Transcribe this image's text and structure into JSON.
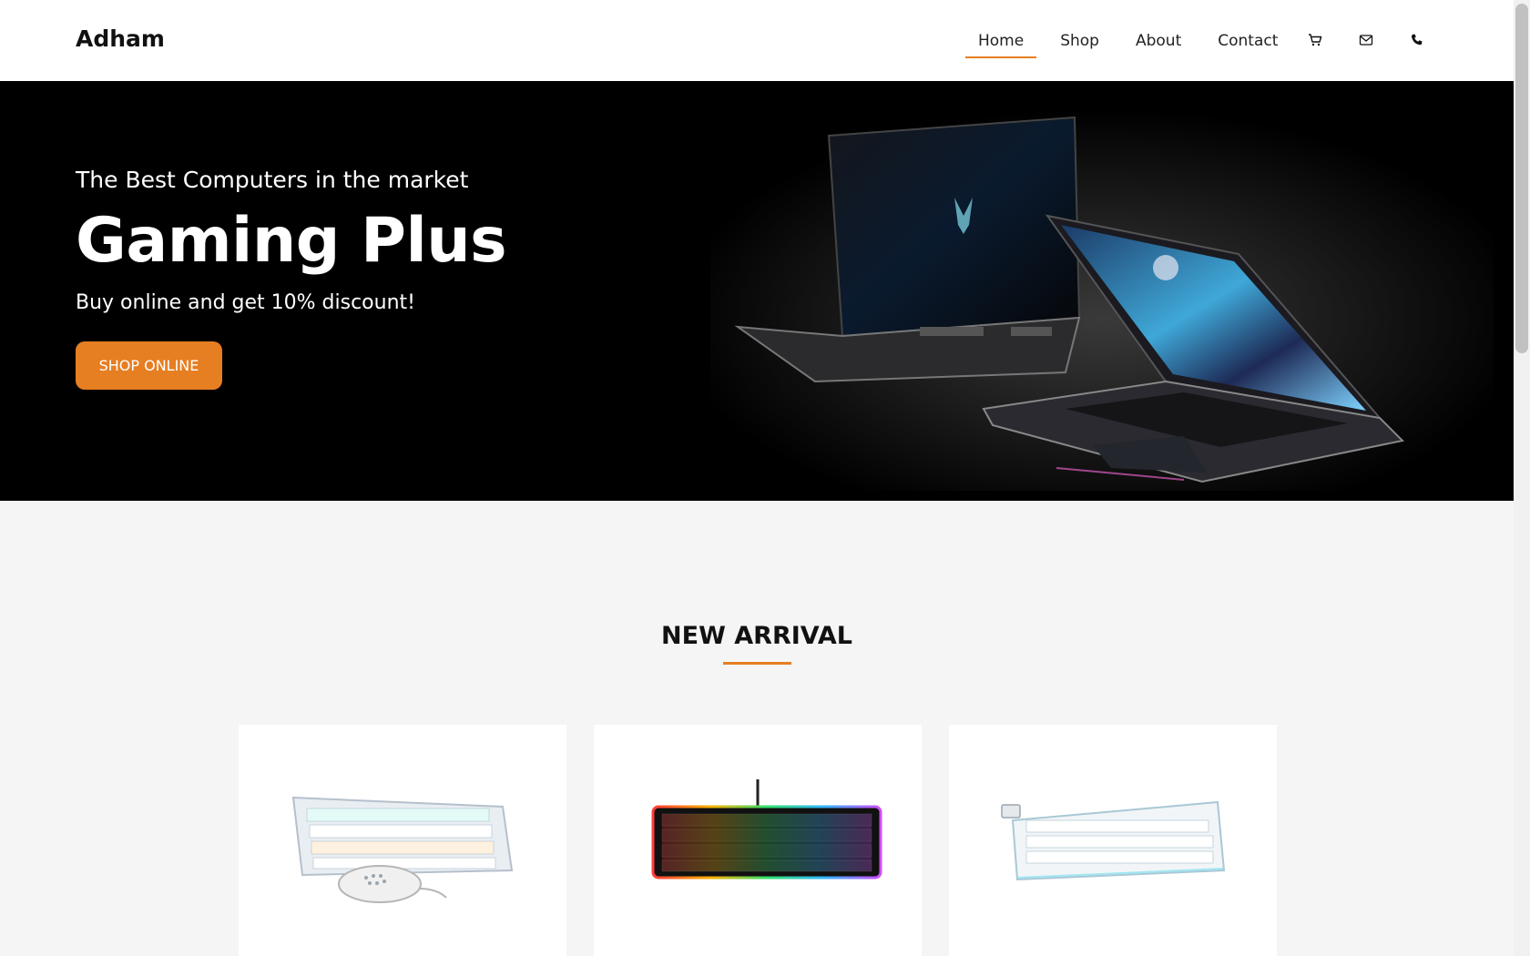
{
  "header": {
    "brand": "Adham",
    "nav": [
      {
        "label": "Home",
        "active": true
      },
      {
        "label": "Shop",
        "active": false
      },
      {
        "label": "About",
        "active": false
      },
      {
        "label": "Contact",
        "active": false
      }
    ],
    "icons": [
      "cart-icon",
      "mail-icon",
      "phone-icon"
    ]
  },
  "hero": {
    "kicker": "The Best Computers in the market",
    "title": "Gaming Plus",
    "subtitle": "Buy online and get 10% discount!",
    "cta_label": "SHOP ONLINE"
  },
  "new_arrival": {
    "title": "NEW ARRIVAL",
    "products": [
      {
        "image": "white keyboard and mouse"
      },
      {
        "image": "black rgb keyboard"
      },
      {
        "image": "white wireless keyboard"
      }
    ]
  },
  "colors": {
    "accent": "#e67e22",
    "hero_bg": "#000000",
    "page_bg": "#f5f5f5"
  }
}
